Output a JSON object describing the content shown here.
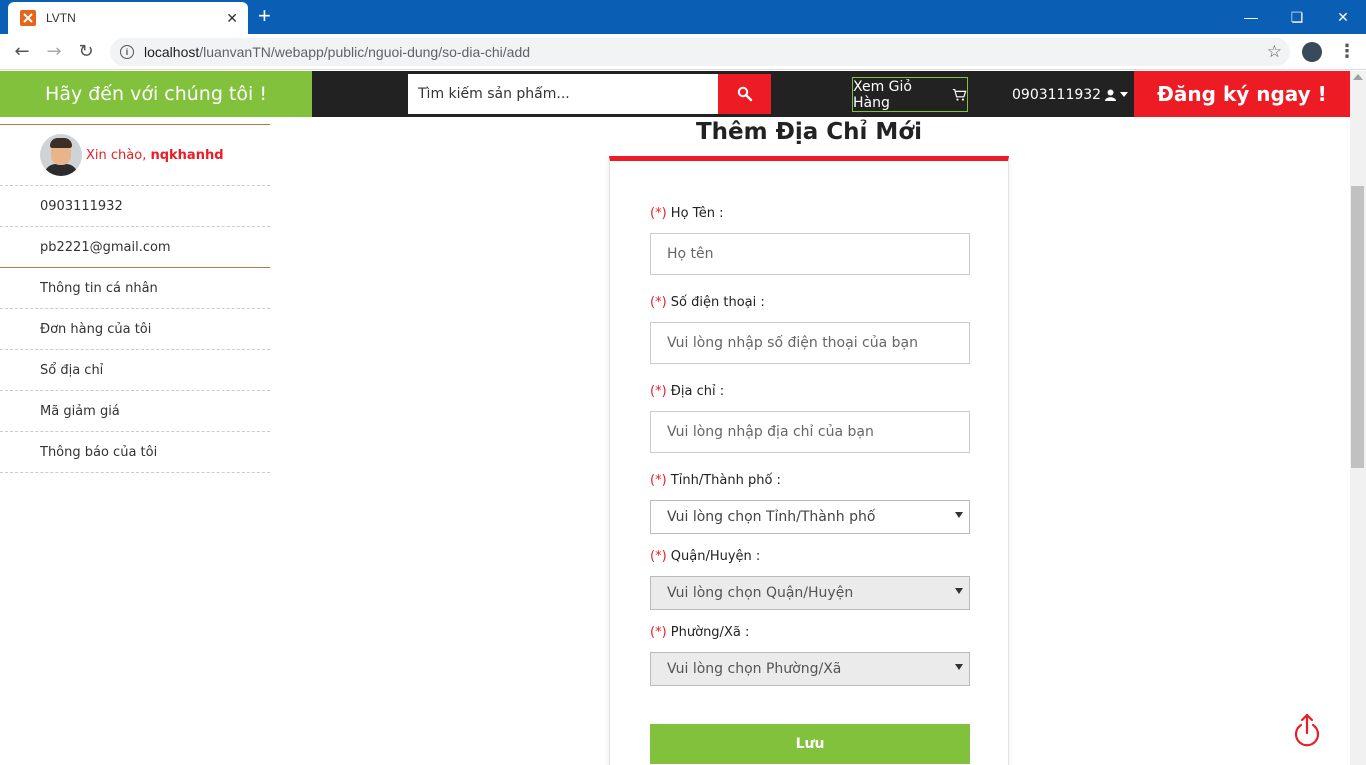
{
  "browser": {
    "tab_title": "LVTN",
    "tab_close": "✕",
    "new_tab": "+",
    "url_host": "localhost",
    "url_path": "/luanvanTN/webapp/public/nguoi-dung/so-dia-chi/add"
  },
  "header": {
    "tagline": "Hãy đến với chúng tôi !",
    "search_placeholder": "Tìm kiếm sản phẩm...",
    "cart_label": "Xem Giỏ Hàng",
    "user_phone": "0903111932",
    "register_label": "Đăng ký ngay !"
  },
  "sidebar": {
    "greeting_prefix": "Xin chào,",
    "username": "nqkhanhd",
    "phone": "0903111932",
    "email": "pb2221@gmail.com",
    "menu": [
      "Thông tin cá nhân",
      "Đơn hàng của tôi",
      "Sổ địa chỉ",
      "Mã giảm giá",
      "Thông báo của tôi"
    ]
  },
  "form": {
    "title": "Thêm Địa Chỉ Mới",
    "required_mark": "(*)",
    "fields": {
      "name": {
        "label": "Họ Tên :",
        "placeholder": "Họ tên"
      },
      "phone": {
        "label": "Số điện thoại :",
        "placeholder": "Vui lòng nhập số điện thoại của bạn"
      },
      "address": {
        "label": "Địa chỉ :",
        "placeholder": "Vui lòng nhập địa chỉ của bạn"
      },
      "province": {
        "label": "Tỉnh/Thành phố :",
        "value": "Vui lòng chọn Tỉnh/Thành phố"
      },
      "district": {
        "label": "Quận/Huyện :",
        "value": "Vui lòng chọn Quận/Huyện"
      },
      "ward": {
        "label": "Phường/Xã :",
        "value": "Vui lòng chọn Phường/Xã"
      }
    },
    "save_label": "Lưu"
  },
  "colors": {
    "green": "#82c13b",
    "red": "#ed1c24",
    "dark": "#222222"
  }
}
